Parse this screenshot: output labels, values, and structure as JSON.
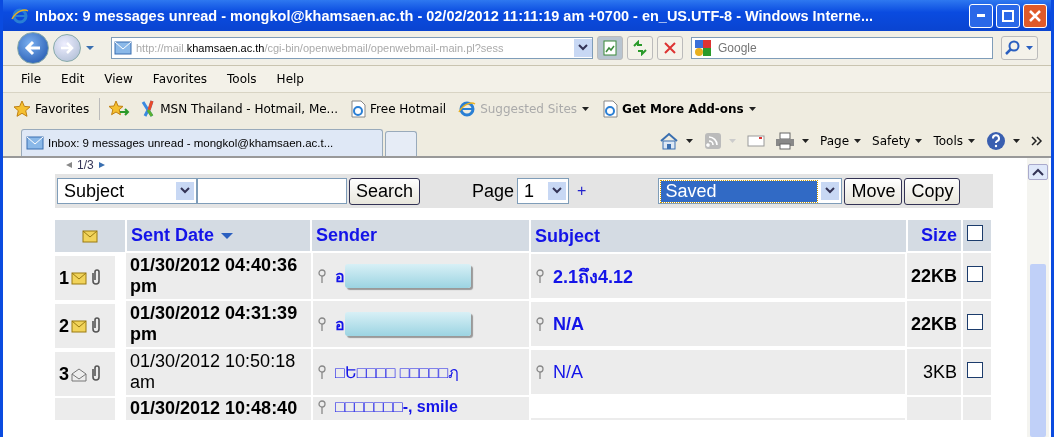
{
  "window": {
    "title": "Inbox: 9 messages unread - mongkol@khamsaen.ac.th - 02/02/2012 11:11:19 am +0700 - en_US.UTF-8  - Windows Interne..."
  },
  "address_bar": {
    "prefix": "http://mail.",
    "domain": "khamsaen.ac.th",
    "path": "/cgi-bin/openwebmail/openwebmail-main.pl?sess"
  },
  "search_box": {
    "placeholder": "Google"
  },
  "menu": [
    "File",
    "Edit",
    "View",
    "Favorites",
    "Tools",
    "Help"
  ],
  "favorites_bar": {
    "label": "Favorites",
    "links": [
      {
        "label": "MSN  Thailand - Hotmail, Me...",
        "kind": "msn",
        "disabled": false,
        "dropdown": false,
        "bold": false
      },
      {
        "label": "Free Hotmail",
        "kind": "page",
        "disabled": false,
        "dropdown": false,
        "bold": false
      },
      {
        "label": "Suggested Sites",
        "kind": "ie",
        "disabled": true,
        "dropdown": true,
        "bold": false
      },
      {
        "label": "Get More Add-ons",
        "kind": "page",
        "disabled": false,
        "dropdown": true,
        "bold": true
      }
    ]
  },
  "tabs": [
    {
      "label": "Inbox: 9 messages unread - mongkol@khamsaen.ac.t...",
      "selected": true
    }
  ],
  "command_bar": [
    "Page",
    "Safety",
    "Tools"
  ],
  "pager": {
    "label": "1/3"
  },
  "search_form": {
    "field": "Subject",
    "button": "Search",
    "page_label": "Page",
    "page": "1",
    "plus": "+",
    "folder": "Saved",
    "move": "Move",
    "copy": "Copy"
  },
  "table": {
    "columns": [
      "Sent Date",
      "Sender",
      "Subject",
      "Size"
    ],
    "select_all": false,
    "rows": [
      {
        "number": "1",
        "kind": "unread",
        "date": "01/30/2012 04:40:36 pm",
        "sender": "อ",
        "sender_redacted": true,
        "subject": "2.1ถึง4.12",
        "size": "22KB",
        "checked": false
      },
      {
        "number": "2",
        "kind": "unread",
        "date": "01/30/2012 04:31:39 pm",
        "sender": "อ",
        "sender_redacted": true,
        "subject": "N/A",
        "size": "22KB",
        "checked": false
      },
      {
        "number": "3",
        "kind": "read",
        "date": "01/30/2012 10:50:18 am",
        "sender": "□Ե□□□□ □□□□□ฦ",
        "sender_redacted": false,
        "subject": "N/A",
        "size": "3KB",
        "checked": false
      },
      {
        "kind": "unread",
        "date": "01/30/2012 10:48:40",
        "sender": "□□□□□□□-, smile",
        "sender_redacted": false
      }
    ]
  }
}
